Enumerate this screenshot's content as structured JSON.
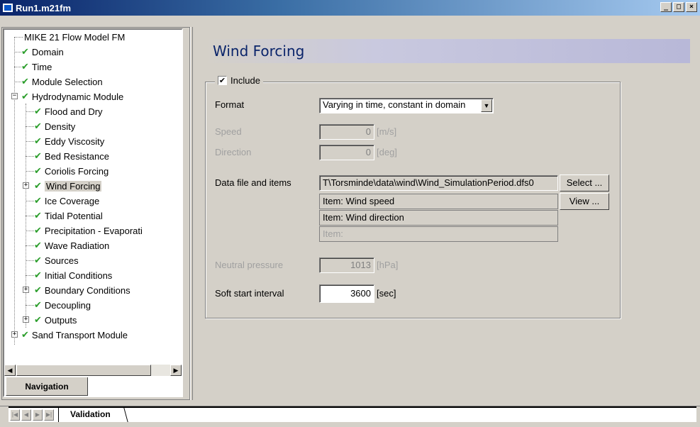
{
  "window": {
    "title": "Run1.m21fm",
    "minimize": "_",
    "maximize": "□",
    "close": "×"
  },
  "tree": {
    "root": "MIKE 21 Flow Model FM",
    "items": [
      {
        "label": "Domain",
        "checked": true
      },
      {
        "label": "Time",
        "checked": true
      },
      {
        "label": "Module Selection",
        "checked": true
      },
      {
        "label": "Hydrodynamic Module",
        "checked": true
      },
      {
        "label": "Flood and Dry",
        "checked": true
      },
      {
        "label": "Density",
        "checked": true
      },
      {
        "label": "Eddy Viscosity",
        "checked": true
      },
      {
        "label": "Bed Resistance",
        "checked": true
      },
      {
        "label": "Coriolis Forcing",
        "checked": true
      },
      {
        "label": "Wind Forcing",
        "checked": true,
        "selected": true
      },
      {
        "label": "Ice Coverage",
        "checked": true
      },
      {
        "label": "Tidal Potential",
        "checked": true
      },
      {
        "label": "Precipitation - Evaporati",
        "checked": true
      },
      {
        "label": "Wave Radiation",
        "checked": true
      },
      {
        "label": "Sources",
        "checked": true
      },
      {
        "label": "Initial Conditions",
        "checked": true
      },
      {
        "label": "Boundary Conditions",
        "checked": true
      },
      {
        "label": "Decoupling",
        "checked": true
      },
      {
        "label": "Outputs",
        "checked": true
      },
      {
        "label": "Sand Transport Module",
        "checked": true
      }
    ],
    "check_glyph": "✔",
    "expand_glyph": "+",
    "collapse_glyph": "−"
  },
  "nav_tab": "Navigation",
  "panel": {
    "title": "Wind Forcing",
    "include_label": "Include",
    "include_checked_glyph": "✔",
    "format_label": "Format",
    "format_value": "Varying in time, constant in domain",
    "speed_label": "Speed",
    "speed_value": "0",
    "speed_unit": "[m/s]",
    "direction_label": "Direction",
    "direction_value": "0",
    "direction_unit": "[deg]",
    "datafile_label": "Data file and items",
    "datafile_value": "T\\Torsminde\\data\\wind\\Wind_SimulationPeriod.dfs0",
    "select_button": "Select ...",
    "view_button": "View ...",
    "item1": "Item:  Wind speed",
    "item2": "Item:  Wind direction",
    "item3": "Item:",
    "neutral_label": "Neutral pressure",
    "neutral_value": "1013",
    "neutral_unit": "[hPa]",
    "softstart_label": "Soft start interval",
    "softstart_value": "3600",
    "softstart_unit": "[sec]"
  },
  "bottom": {
    "first": "|◀",
    "prev": "◀",
    "next": "▶",
    "last": "▶|",
    "tab": "Validation"
  },
  "scroll": {
    "left": "◀",
    "right": "▶"
  }
}
